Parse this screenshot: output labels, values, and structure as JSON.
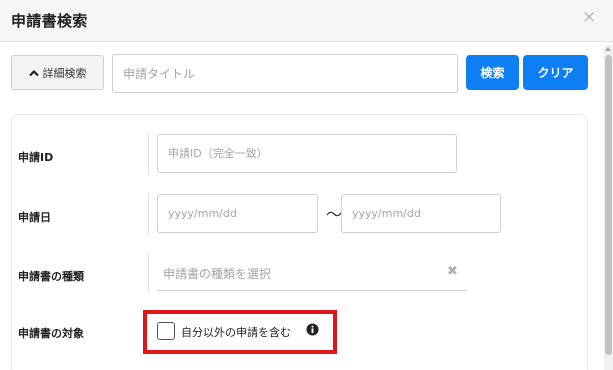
{
  "dialog": {
    "title": "申請書検索",
    "close_icon": "×"
  },
  "search_bar": {
    "advanced_label": "詳細検索",
    "title_placeholder": "申請タイトル",
    "title_value": "",
    "search_label": "検索",
    "clear_label": "クリア"
  },
  "form": {
    "id_label": "申請ID",
    "id_placeholder": "申請ID（完全一致）",
    "date_label": "申請日",
    "date_from_placeholder": "yyyy/mm/dd",
    "date_separator": "〜",
    "date_to_placeholder": "yyyy/mm/dd",
    "type_label": "申請書の種類",
    "type_placeholder": "申請書の種類を選択",
    "type_clear_icon": "✖",
    "target_label": "申請書の対象",
    "include_others_label": "自分以外の申請を含む",
    "include_others_checked": false
  },
  "colors": {
    "primary": "#0d7ff2",
    "highlight": "#e0151c",
    "header_bg": "#f6f6f6"
  },
  "icons": {
    "advanced": "chevron-up-icon",
    "close": "close-icon",
    "info": "info-circle-icon",
    "select_clear": "clear-icon"
  }
}
